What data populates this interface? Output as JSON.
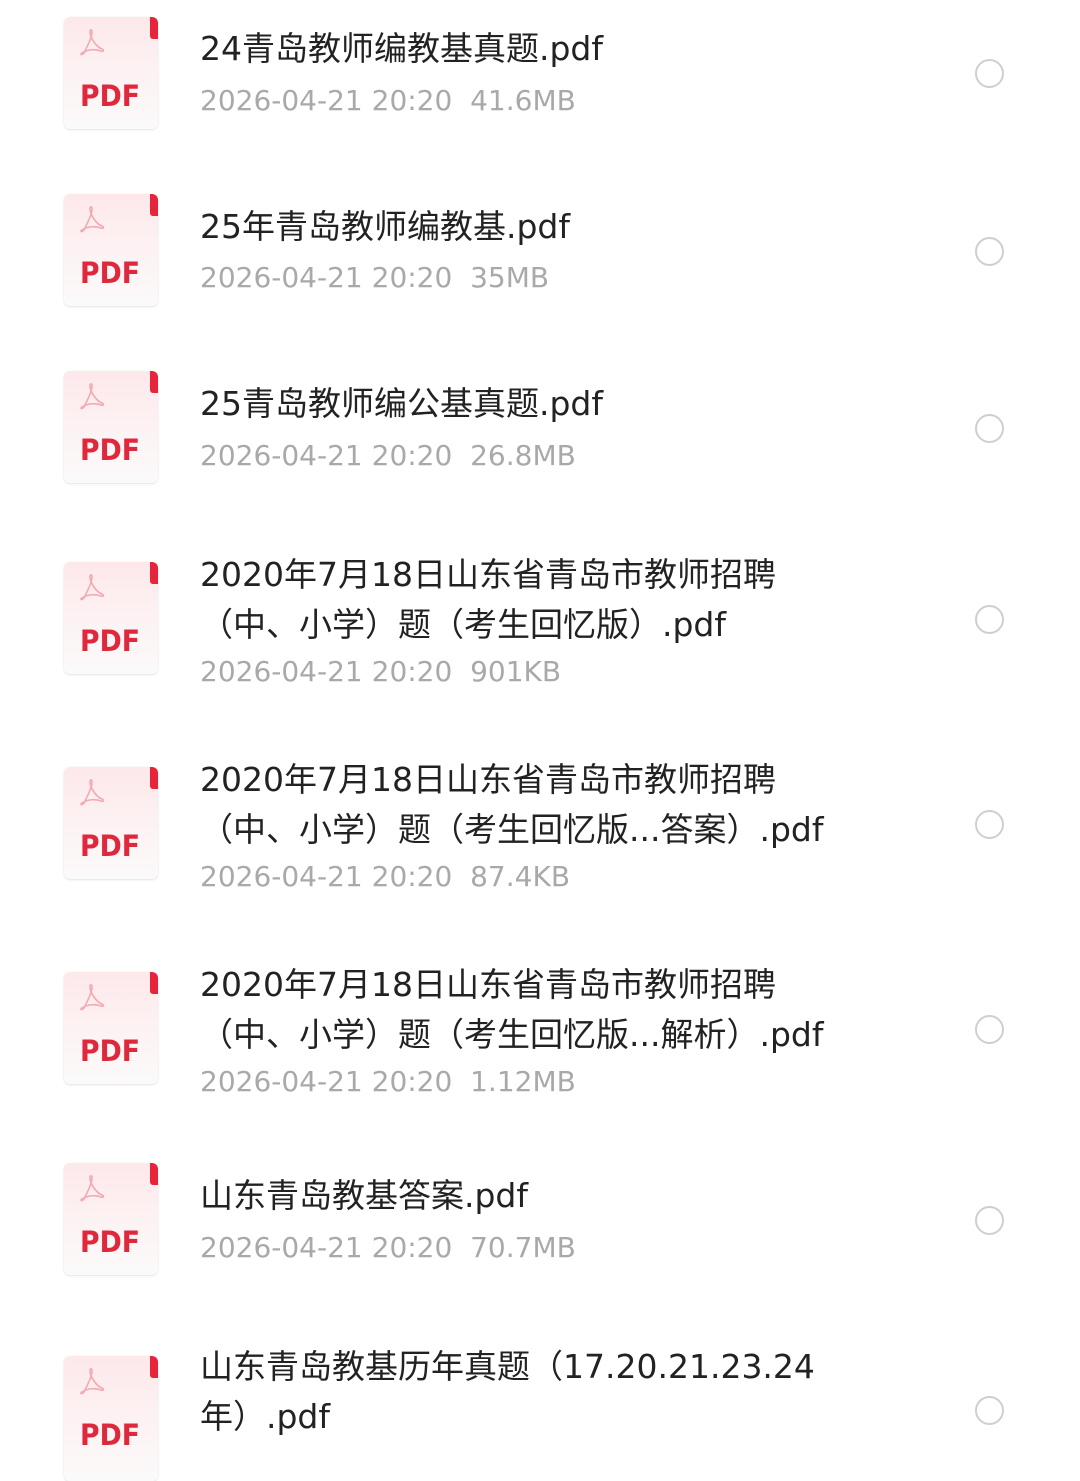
{
  "files": [
    {
      "name": "24青岛教师编教基真题.pdf",
      "meta": "2026-04-21 20:20  41.6MB",
      "icon_label": "PDF",
      "icon": "pdf-file-icon"
    },
    {
      "name": "25年青岛教师编教基.pdf",
      "meta": "2026-04-21 20:20  35MB",
      "icon_label": "PDF",
      "icon": "pdf-file-icon"
    },
    {
      "name": "25青岛教师编公基真题.pdf",
      "meta": "2026-04-21 20:20  26.8MB",
      "icon_label": "PDF",
      "icon": "pdf-file-icon"
    },
    {
      "name": "2020年7月18日山东省青岛市教师招聘（中、小学）题（考生回忆版）.pdf",
      "meta": "2026-04-21 20:20  901KB",
      "icon_label": "PDF",
      "icon": "pdf-file-icon"
    },
    {
      "name": "2020年7月18日山东省青岛市教师招聘（中、小学）题（考生回忆版...答案）.pdf",
      "meta": "2026-04-21 20:20  87.4KB",
      "icon_label": "PDF",
      "icon": "pdf-file-icon"
    },
    {
      "name": "2020年7月18日山东省青岛市教师招聘（中、小学）题（考生回忆版...解析）.pdf",
      "meta": "2026-04-21 20:20  1.12MB",
      "icon_label": "PDF",
      "icon": "pdf-file-icon"
    },
    {
      "name": "山东青岛教基答案.pdf",
      "meta": "2026-04-21 20:20  70.7MB",
      "icon_label": "PDF",
      "icon": "pdf-file-icon"
    },
    {
      "name": "山东青岛教基历年真题（17.20.21.23.24年）.pdf",
      "meta": "",
      "icon_label": "PDF",
      "icon": "pdf-file-icon"
    }
  ],
  "colors": {
    "pdf_red": "#e0283d",
    "name_text": "#222222",
    "meta_text": "#a9a9a9",
    "radio_border": "#cfcfcf"
  }
}
